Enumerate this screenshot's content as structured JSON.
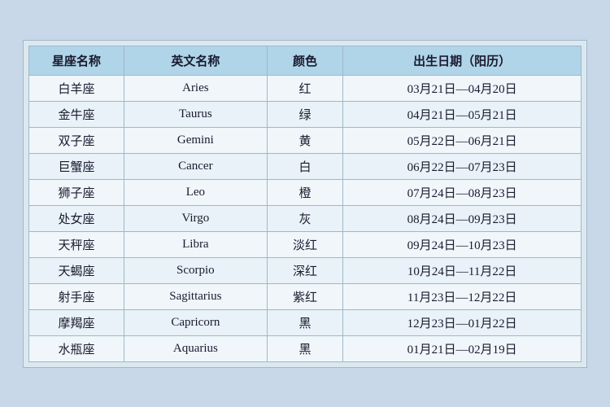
{
  "table": {
    "headers": {
      "zh_name": "星座名称",
      "en_name": "英文名称",
      "color": "颜色",
      "date_range": "出生日期（阳历）"
    },
    "rows": [
      {
        "zh": "白羊座",
        "en": "Aries",
        "color": "红",
        "date": "03月21日—04月20日"
      },
      {
        "zh": "金牛座",
        "en": "Taurus",
        "color": "绿",
        "date": "04月21日—05月21日"
      },
      {
        "zh": "双子座",
        "en": "Gemini",
        "color": "黄",
        "date": "05月22日—06月21日"
      },
      {
        "zh": "巨蟹座",
        "en": "Cancer",
        "color": "白",
        "date": "06月22日—07月23日"
      },
      {
        "zh": "狮子座",
        "en": "Leo",
        "color": "橙",
        "date": "07月24日—08月23日"
      },
      {
        "zh": "处女座",
        "en": "Virgo",
        "color": "灰",
        "date": "08月24日—09月23日"
      },
      {
        "zh": "天秤座",
        "en": "Libra",
        "color": "淡红",
        "date": "09月24日—10月23日"
      },
      {
        "zh": "天蝎座",
        "en": "Scorpio",
        "color": "深红",
        "date": "10月24日—11月22日"
      },
      {
        "zh": "射手座",
        "en": "Sagittarius",
        "color": "紫红",
        "date": "11月23日—12月22日"
      },
      {
        "zh": "摩羯座",
        "en": "Capricorn",
        "color": "黑",
        "date": "12月23日—01月22日"
      },
      {
        "zh": "水瓶座",
        "en": "Aquarius",
        "color": "黑",
        "date": "01月21日—02月19日"
      }
    ]
  }
}
